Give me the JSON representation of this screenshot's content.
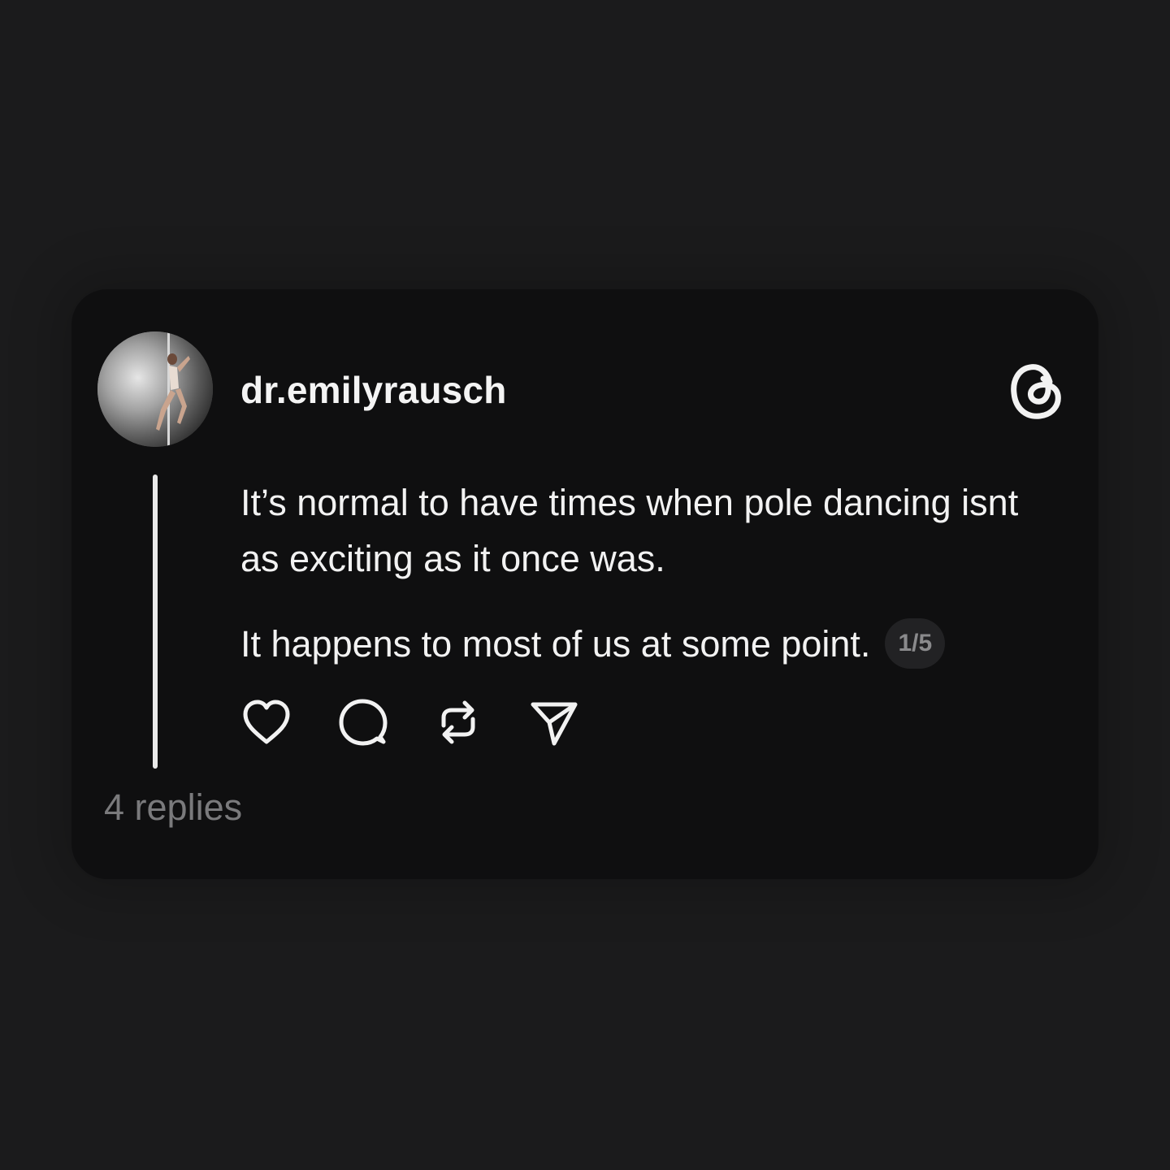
{
  "post": {
    "username": "dr.emilyrausch",
    "paragraphs": [
      "It’s normal to have times when pole dancing isnt as exciting as it once was.",
      "It happens to most of us at some point."
    ],
    "page_indicator": "1/5",
    "replies_label": "4 replies"
  },
  "icons": {
    "avatar": "avatar-photo",
    "brand": "threads-logo-icon",
    "actions": [
      "heart-icon",
      "comment-icon",
      "repost-icon",
      "share-icon"
    ]
  },
  "colors": {
    "background": "#1b1b1c",
    "card": "#0f0f10",
    "text": "#f2f2f2",
    "muted": "#7a7a7c"
  }
}
